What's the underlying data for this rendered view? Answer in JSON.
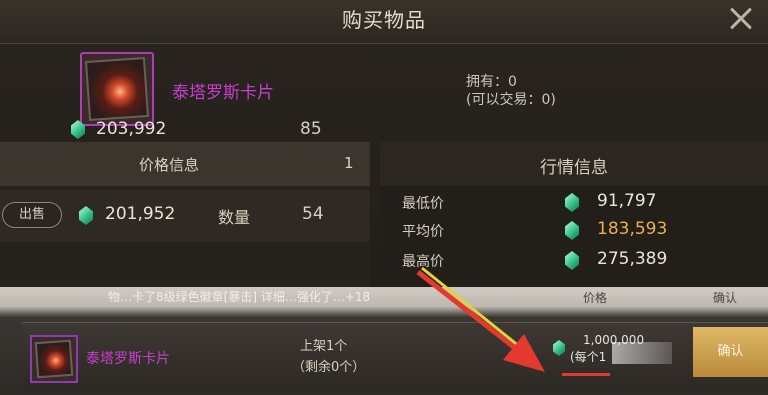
{
  "window": {
    "title": "购买物品"
  },
  "item": {
    "name": "泰塔罗斯卡片",
    "owned": "拥有：0",
    "tradable": "(可以交易：0)"
  },
  "price_info": {
    "header": "价格信息",
    "page": "1",
    "rows": [
      {
        "action": "出售",
        "price": "201,952",
        "qty_label": "数量",
        "qty": "54"
      },
      {
        "price": "203,992",
        "qty": "85"
      }
    ]
  },
  "market_info": {
    "header": "行情信息",
    "stats": [
      {
        "label": "最低价",
        "value": "91,797"
      },
      {
        "label": "平均价",
        "value": "183,593"
      },
      {
        "label": "最高价",
        "value": "275,389"
      }
    ]
  },
  "listing": {
    "notice": "物…卡了8级绿色徽章[暴击] 详细…强化了…+18",
    "col_price": "价格",
    "col_confirm": "确认",
    "name": "泰塔罗斯卡片",
    "listed": "上架1个",
    "remaining": "（剩余0个）",
    "price": "1,000,000",
    "each": "(每个1",
    "button": "确认"
  },
  "colors": {
    "accent_purple": "#c83ed0",
    "gold": "#e8b24c",
    "gem": "#35c08a",
    "arrow": "#e23a2e"
  },
  "icons": [
    "close-icon",
    "gem-icon",
    "card-icon",
    "arrow-icon"
  ]
}
